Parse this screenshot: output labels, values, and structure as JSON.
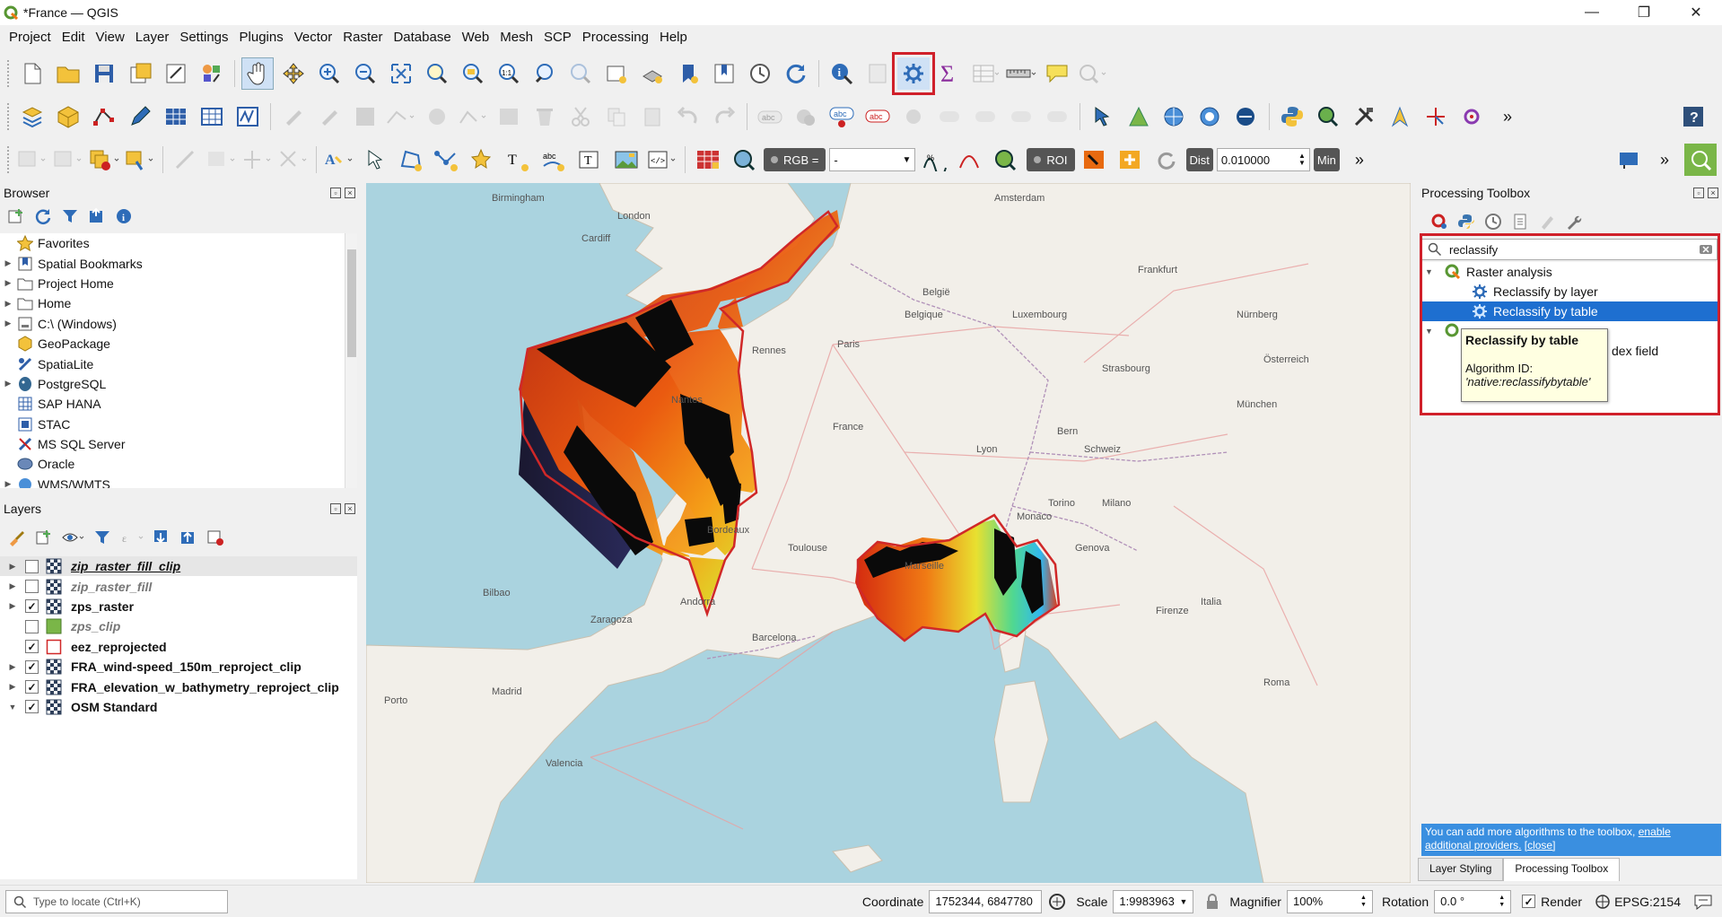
{
  "app": {
    "title": "*France — QGIS"
  },
  "menu": [
    "Project",
    "Edit",
    "View",
    "Layer",
    "Settings",
    "Plugins",
    "Vector",
    "Raster",
    "Database",
    "Web",
    "Mesh",
    "SCP",
    "Processing",
    "Help"
  ],
  "toolbar3": {
    "rgb_label": "RGB =",
    "rgb_value": "-",
    "roi_label": "ROI",
    "dist_label": "Dist",
    "dist_value": "0.010000",
    "min_label": "Min"
  },
  "browser": {
    "title": "Browser",
    "items": [
      {
        "label": "Favorites",
        "icon": "star-icon",
        "expand": false
      },
      {
        "label": "Spatial Bookmarks",
        "icon": "bookmark-icon",
        "expand": true
      },
      {
        "label": "Project Home",
        "icon": "folder-icon",
        "expand": true
      },
      {
        "label": "Home",
        "icon": "folder-icon",
        "expand": true
      },
      {
        "label": "C:\\ (Windows)",
        "icon": "drive-icon",
        "expand": true
      },
      {
        "label": "GeoPackage",
        "icon": "geopackage-icon",
        "expand": false
      },
      {
        "label": "SpatiaLite",
        "icon": "spatialite-icon",
        "expand": false
      },
      {
        "label": "PostgreSQL",
        "icon": "postgresql-icon",
        "expand": true
      },
      {
        "label": "SAP HANA",
        "icon": "saphana-icon",
        "expand": false
      },
      {
        "label": "STAC",
        "icon": "stac-icon",
        "expand": false
      },
      {
        "label": "MS SQL Server",
        "icon": "mssql-icon",
        "expand": false
      },
      {
        "label": "Oracle",
        "icon": "oracle-icon",
        "expand": false
      },
      {
        "label": "WMS/WMTS",
        "icon": "wms-icon",
        "expand": true
      }
    ]
  },
  "layers": {
    "title": "Layers",
    "items": [
      {
        "label": "zip_raster_fill_clip",
        "checked": false,
        "style": "italic-bold-underline",
        "icon": "raster-icon",
        "expand": true
      },
      {
        "label": "zip_raster_fill",
        "checked": false,
        "style": "italic-gray",
        "icon": "raster-icon",
        "expand": true
      },
      {
        "label": "zps_raster",
        "checked": true,
        "style": "bold",
        "icon": "raster-icon",
        "expand": true
      },
      {
        "label": "zps_clip",
        "checked": false,
        "style": "italic-gray",
        "icon": "polygon-green-icon",
        "expand": false
      },
      {
        "label": "eez_reprojected",
        "checked": true,
        "style": "bold",
        "icon": "polygon-outline-icon",
        "expand": false
      },
      {
        "label": "FRA_wind-speed_150m_reproject_clip",
        "checked": true,
        "style": "bold",
        "icon": "raster-icon",
        "expand": true
      },
      {
        "label": "FRA_elevation_w_bathymetry_reproject_clip",
        "checked": true,
        "style": "bold",
        "icon": "raster-icon",
        "expand": true
      },
      {
        "label": "OSM Standard",
        "checked": true,
        "style": "bold",
        "icon": "raster-icon",
        "expand": true
      }
    ]
  },
  "map": {
    "places": [
      {
        "name": "Birmingham"
      },
      {
        "name": "London"
      },
      {
        "name": "Cardiff"
      },
      {
        "name": "Amsterdam"
      },
      {
        "name": "Belgique"
      },
      {
        "name": "België"
      },
      {
        "name": "Paris"
      },
      {
        "name": "Rennes"
      },
      {
        "name": "Nantes"
      },
      {
        "name": "France"
      },
      {
        "name": "Bordeaux"
      },
      {
        "name": "Toulouse"
      },
      {
        "name": "Lyon"
      },
      {
        "name": "Marseille"
      },
      {
        "name": "Monaco"
      },
      {
        "name": "Milano"
      },
      {
        "name": "Torino"
      },
      {
        "name": "Genova"
      },
      {
        "name": "Bern"
      },
      {
        "name": "Schweiz"
      },
      {
        "name": "Strasbourg"
      },
      {
        "name": "München"
      },
      {
        "name": "Nürnberg"
      },
      {
        "name": "Frankfurt"
      },
      {
        "name": "Luxembourg"
      },
      {
        "name": "Österreich"
      },
      {
        "name": "Zaragoza"
      },
      {
        "name": "Barcelona"
      },
      {
        "name": "Andorra"
      },
      {
        "name": "Madrid"
      },
      {
        "name": "Valencia"
      },
      {
        "name": "Bilbao"
      },
      {
        "name": "Italia"
      },
      {
        "name": "Firenze"
      },
      {
        "name": "Porto"
      },
      {
        "name": "Roma"
      }
    ]
  },
  "toolbox": {
    "title": "Processing Toolbox",
    "search_value": "reclassify",
    "group1": "Raster analysis",
    "item1": "Reclassify by layer",
    "item2": "Reclassify by table",
    "item3_partial": "dex field",
    "tooltip": {
      "title": "Reclassify by table",
      "id_label": "Algorithm ID:",
      "id_value": "'native:reclassifybytable'"
    },
    "notice": {
      "text": "You can add more algorithms to the toolbox,",
      "link1": "enable additional providers.",
      "link2": "[close]"
    },
    "tabs": [
      "Layer Styling",
      "Processing Toolbox"
    ]
  },
  "status": {
    "locate_placeholder": "Type to locate (Ctrl+K)",
    "coordinate_label": "Coordinate",
    "coordinate_value": "1752344, 6847780",
    "scale_label": "Scale",
    "scale_value": "1:9983963",
    "magnifier_label": "Magnifier",
    "magnifier_value": "100%",
    "rotation_label": "Rotation",
    "rotation_value": "0.0 °",
    "render_label": "Render",
    "epsg": "EPSG:2154"
  },
  "colors": {
    "highlight_red": "#d0202a",
    "selection_blue": "#1e6fd0",
    "sea": "#aad3df",
    "land": "#f2efe9"
  }
}
